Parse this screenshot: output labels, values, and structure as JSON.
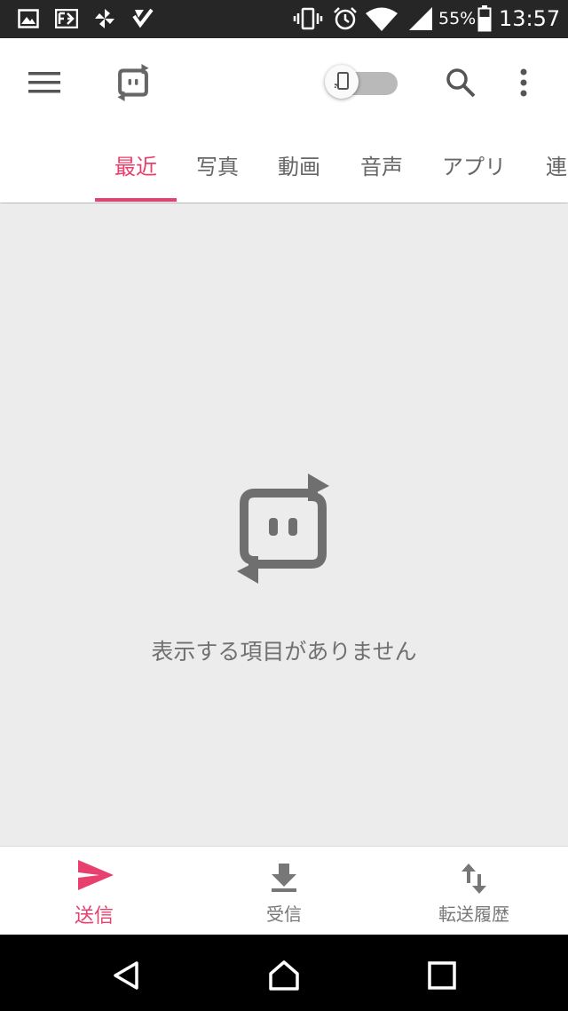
{
  "status_bar": {
    "battery_percent": "55%",
    "time": "13:57",
    "icons": [
      "image-icon",
      "fc-app-icon",
      "pinwheel-icon",
      "check-bolt-icon",
      "vibrate-icon",
      "alarm-icon",
      "wifi-icon",
      "signal-icon",
      "battery-icon"
    ]
  },
  "toolbar": {
    "menu_icon": "hamburger-menu-icon",
    "logo_icon": "send-anywhere-logo-icon",
    "toggle_state": "off",
    "search_icon": "search-icon",
    "more_icon": "more-vert-icon"
  },
  "tabs": [
    {
      "label": "最近",
      "active": true
    },
    {
      "label": "写真",
      "active": false
    },
    {
      "label": "動画",
      "active": false
    },
    {
      "label": "音声",
      "active": false
    },
    {
      "label": "アプリ",
      "active": false
    },
    {
      "label": "連",
      "active": false
    }
  ],
  "empty_state": {
    "icon": "send-anywhere-logo-icon",
    "message": "表示する項目がありません"
  },
  "bottom_nav": [
    {
      "label": "送信",
      "icon": "send-icon",
      "active": true
    },
    {
      "label": "受信",
      "icon": "download-icon",
      "active": false
    },
    {
      "label": "転送履歴",
      "icon": "swap-vert-icon",
      "active": false
    }
  ],
  "system_nav": [
    "back-icon",
    "home-icon",
    "recents-icon"
  ],
  "colors": {
    "accent": "#e8406e",
    "status_bar": "#262626",
    "background": "#ececec",
    "icon_gray": "#777777"
  }
}
